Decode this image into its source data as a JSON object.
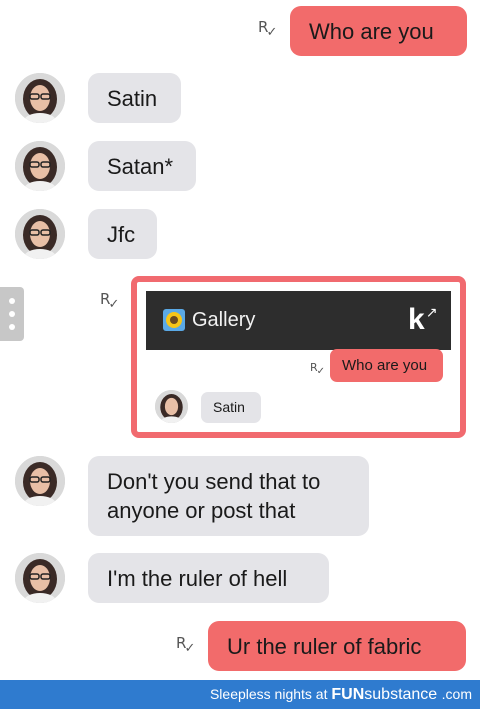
{
  "messages": [
    {
      "sender": "me",
      "text": "Who are you"
    },
    {
      "sender": "them",
      "text": "Satin"
    },
    {
      "sender": "them",
      "text": "Satan*"
    },
    {
      "sender": "them",
      "text": "Jfc"
    },
    {
      "sender": "them",
      "text": "Don't you send that to anyone or post that"
    },
    {
      "sender": "them",
      "text": "I'm the ruler of hell"
    },
    {
      "sender": "me",
      "text": "Ur the ruler of fabric"
    }
  ],
  "receipt_glyph": "R",
  "shared_card": {
    "title": "Gallery",
    "app_icon": "sunflower-icon",
    "logo": "k",
    "messages": [
      {
        "sender": "me",
        "text": "Who are you"
      },
      {
        "sender": "them",
        "text": "Satin"
      }
    ]
  },
  "footer": {
    "prefix": "Sleepless nights at",
    "brand_bold": "FUN",
    "brand_rest": "substance",
    "domain": ".com"
  },
  "colors": {
    "sent_bubble": "#f26b6b",
    "received_bubble": "#e4e4e8",
    "card_border": "#f16a6f",
    "footer": "#2f7bcf"
  }
}
